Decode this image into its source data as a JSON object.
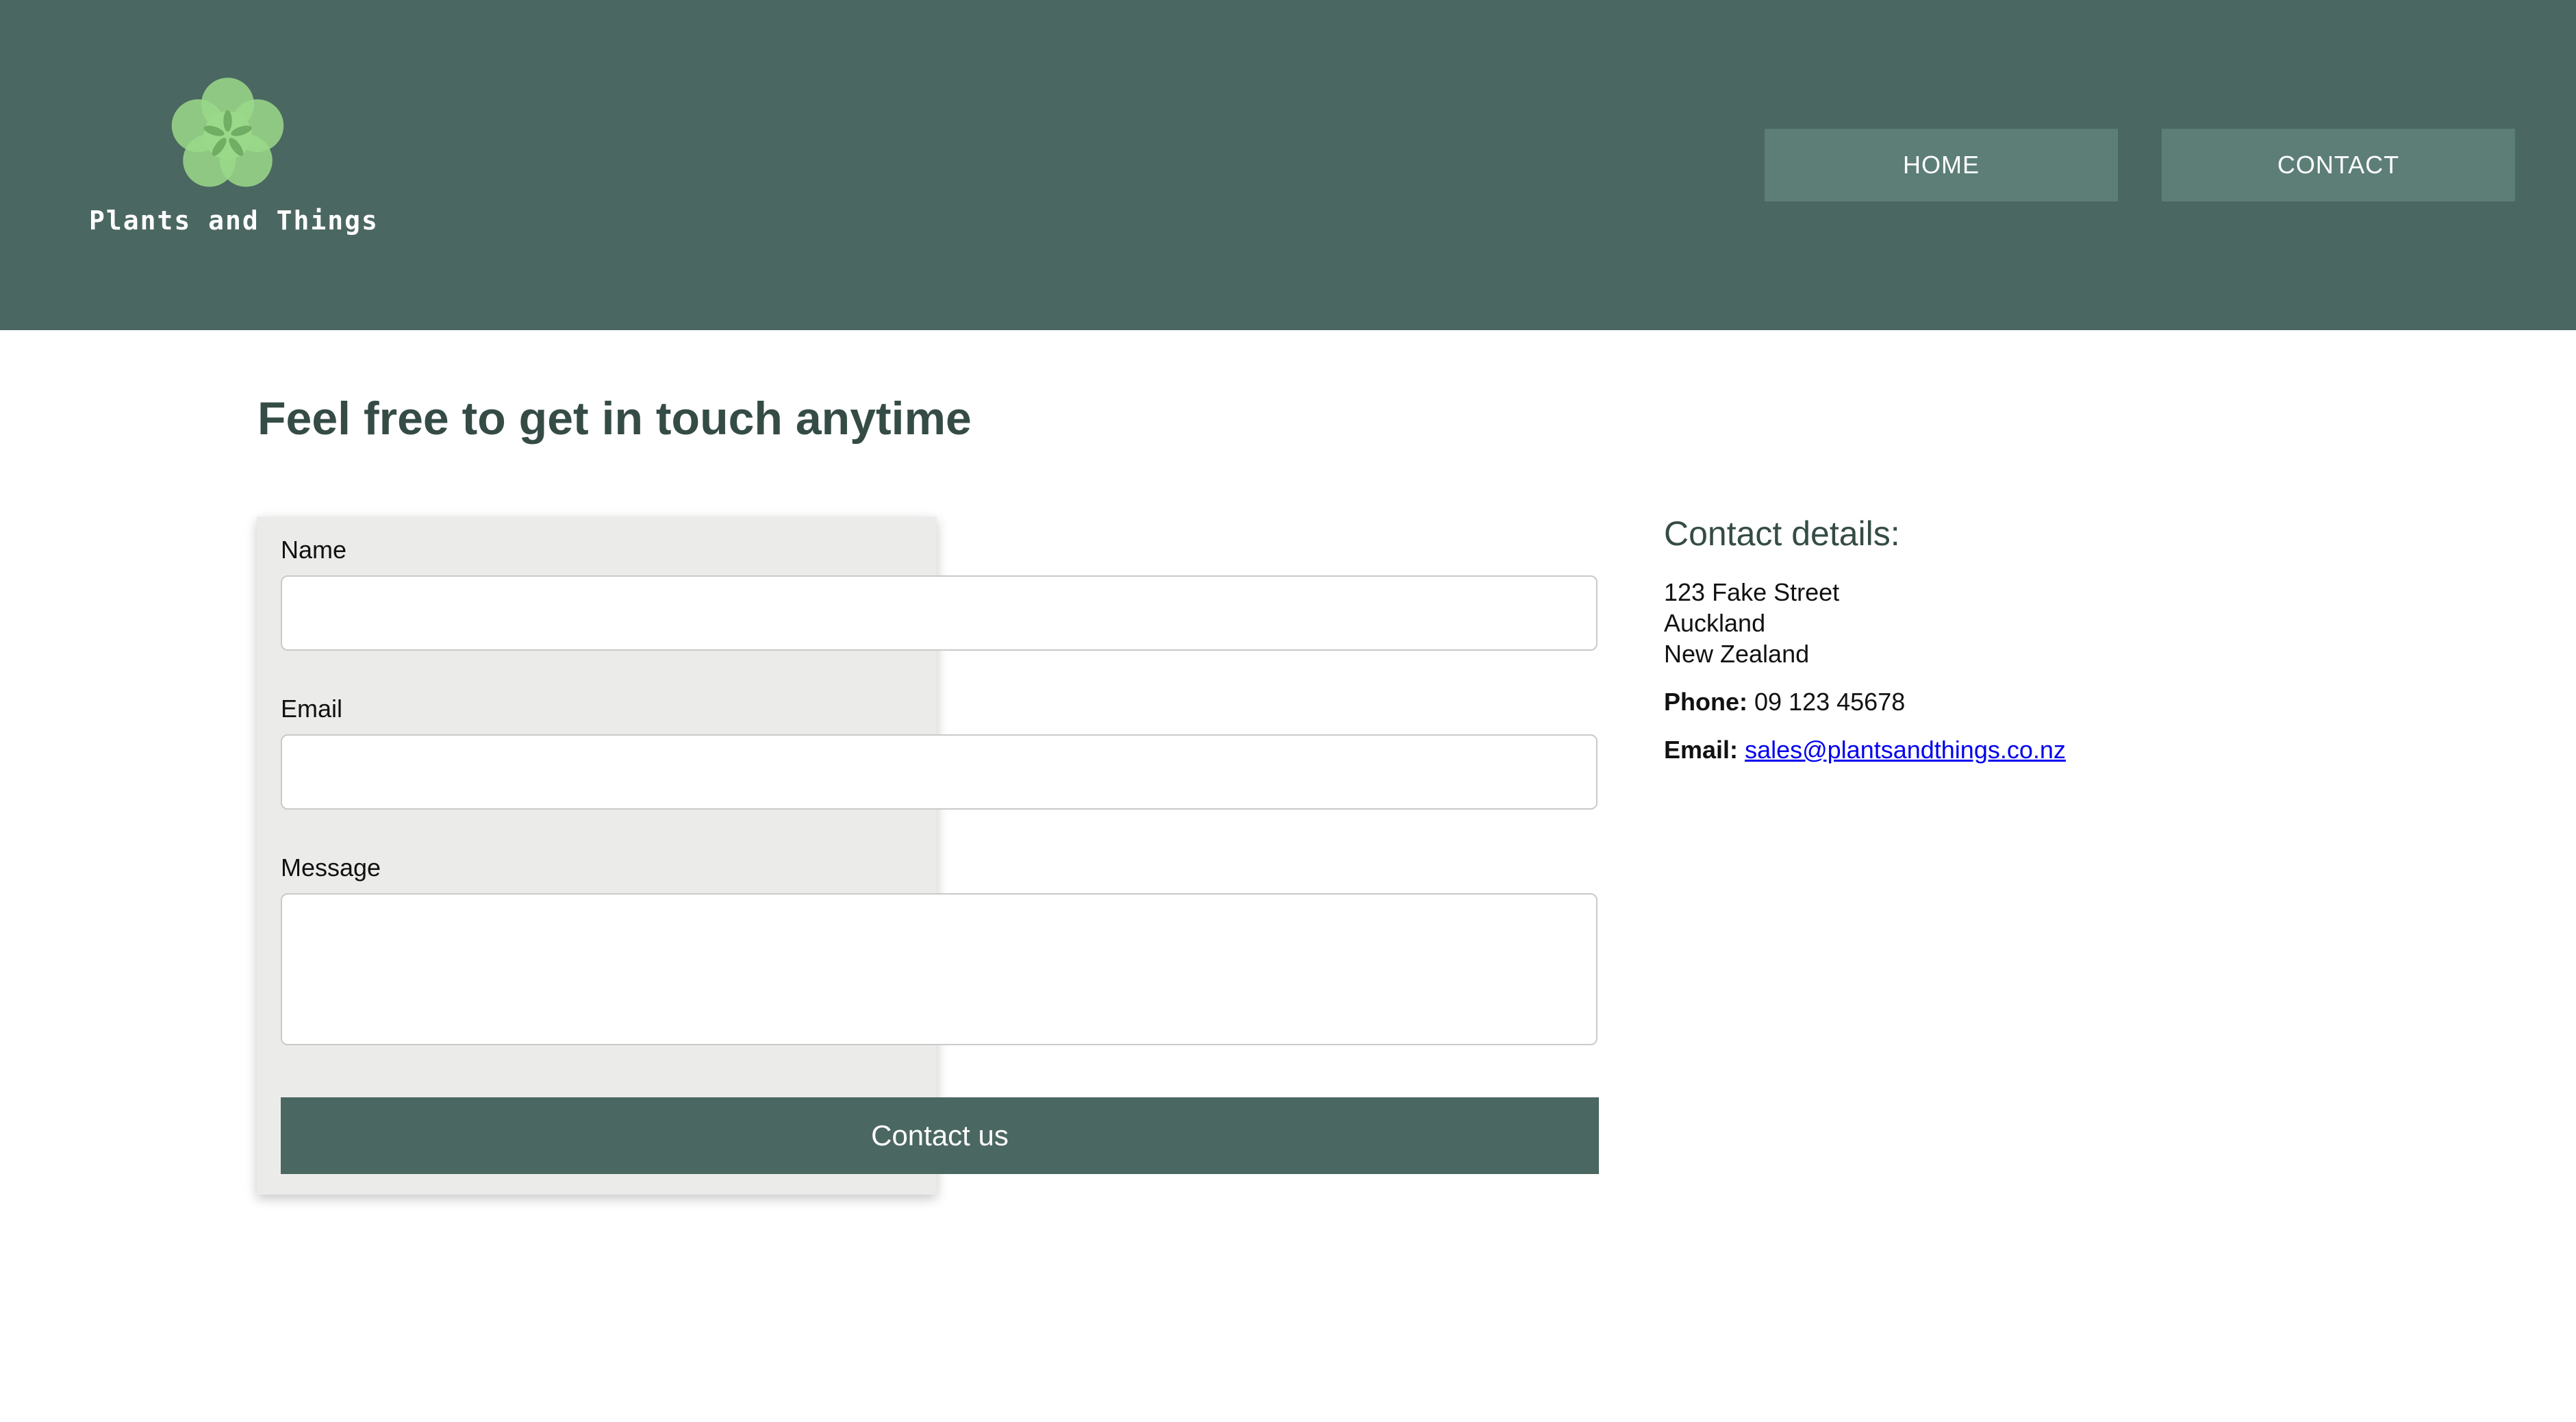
{
  "brand": {
    "name": "Plants and Things",
    "logo_icon": "flower-logo-icon",
    "colors": {
      "header_bg": "#4b6761",
      "nav_button_bg": "#5d7e77",
      "logo_green": "#9bd98a",
      "heading": "#354c46",
      "form_bg": "#ebecea",
      "link": "#0000ee"
    }
  },
  "nav": {
    "items": [
      {
        "label": "HOME"
      },
      {
        "label": "CONTACT"
      }
    ]
  },
  "main": {
    "title": "Feel free to get in touch anytime"
  },
  "form": {
    "name_label": "Name",
    "name_value": "",
    "email_label": "Email",
    "email_value": "",
    "message_label": "Message",
    "message_value": "",
    "submit_label": "Contact us"
  },
  "contact_details": {
    "heading": "Contact details:",
    "address": [
      "123 Fake Street",
      "Auckland",
      "New Zealand"
    ],
    "phone_label": "Phone:",
    "phone": "09 123 45678",
    "email_label": "Email:",
    "email": "sales@plantsandthings.co.nz"
  }
}
